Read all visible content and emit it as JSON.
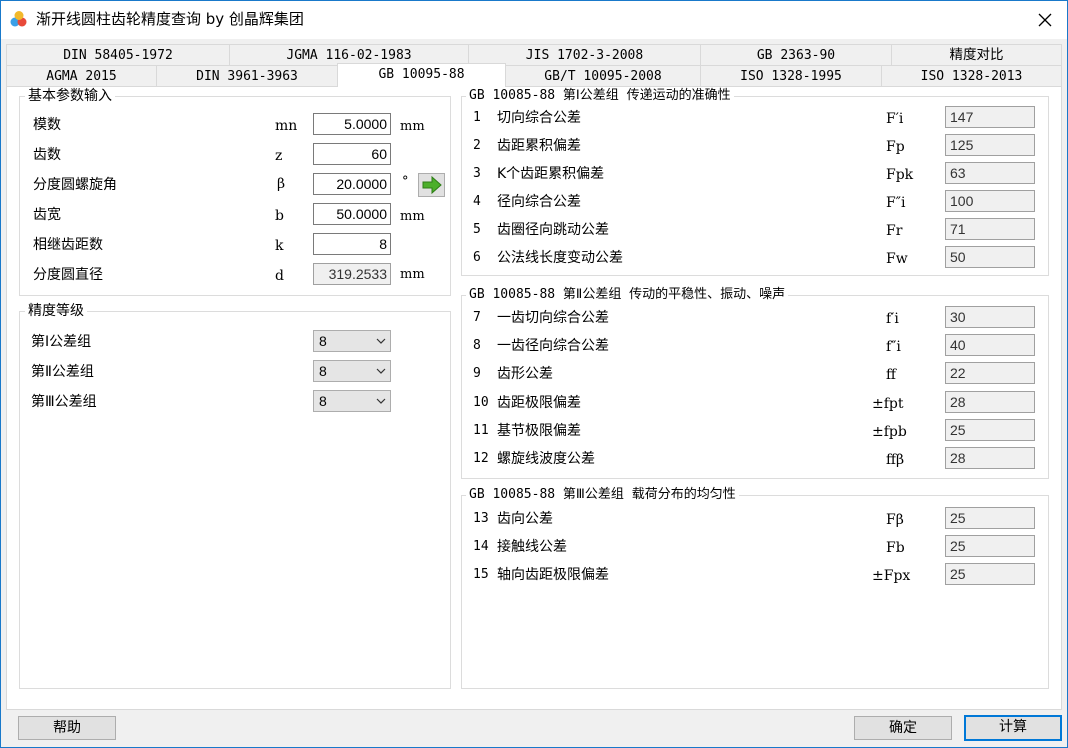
{
  "window": {
    "title": "渐开线圆柱齿轮精度查询 by 创晶辉集团"
  },
  "tabs_row1": [
    "DIN 58405-1972",
    "JGMA 116-02-1983",
    "JIS 1702-3-2008",
    "GB 2363-90",
    "精度对比"
  ],
  "tabs_row2": [
    "AGMA 2015",
    "DIN 3961-3963",
    "GB 10095-88",
    "GB/T 10095-2008",
    "ISO 1328-1995",
    "ISO 1328-2013"
  ],
  "basic_params": {
    "title": "基本参数输入",
    "rows": [
      {
        "label": "模数",
        "symbol": "mn",
        "value": "5.0000",
        "unit": "mm"
      },
      {
        "label": "齿数",
        "symbol": "z",
        "value": "60",
        "unit": ""
      },
      {
        "label": "分度圆螺旋角",
        "symbol": "β",
        "value": "20.0000",
        "unit": "°"
      },
      {
        "label": "齿宽",
        "symbol": "b",
        "value": "50.0000",
        "unit": "mm"
      },
      {
        "label": "相继齿距数",
        "symbol": "k",
        "value": "8",
        "unit": ""
      },
      {
        "label": "分度圆直径",
        "symbol": "d",
        "value": "319.2533",
        "unit": "mm"
      }
    ]
  },
  "accuracy": {
    "title": "精度等级",
    "rows": [
      {
        "label": "第Ⅰ公差组",
        "value": "8"
      },
      {
        "label": "第Ⅱ公差组",
        "value": "8"
      },
      {
        "label": "第Ⅲ公差组",
        "value": "8"
      }
    ]
  },
  "group1": {
    "title": "GB 10085-88 第Ⅰ公差组 传递运动的准确性",
    "rows": [
      {
        "no": "1",
        "name": "切向综合公差",
        "symbol": "F′i",
        "value": "147"
      },
      {
        "no": "2",
        "name": "齿距累积偏差",
        "symbol": "Fp",
        "value": "125"
      },
      {
        "no": "3",
        "name": "K个齿距累积偏差",
        "symbol": "Fpk",
        "value": "63"
      },
      {
        "no": "4",
        "name": "径向综合公差",
        "symbol": "F″i",
        "value": "100"
      },
      {
        "no": "5",
        "name": "齿圈径向跳动公差",
        "symbol": "Fr",
        "value": "71"
      },
      {
        "no": "6",
        "name": "公法线长度变动公差",
        "symbol": "Fw",
        "value": "50"
      }
    ]
  },
  "group2": {
    "title": "GB 10085-88 第Ⅱ公差组 传动的平稳性、振动、噪声",
    "rows": [
      {
        "no": "7",
        "name": "一齿切向综合公差",
        "symbol": "f′i",
        "value": "30"
      },
      {
        "no": "8",
        "name": "一齿径向综合公差",
        "symbol": "f″i",
        "value": "40"
      },
      {
        "no": "9",
        "name": "齿形公差",
        "symbol": "ff",
        "value": "22"
      },
      {
        "no": "10",
        "name": "齿距极限偏差",
        "symbol": "±fpt",
        "value": "28"
      },
      {
        "no": "11",
        "name": "基节极限偏差",
        "symbol": "±fpb",
        "value": "25"
      },
      {
        "no": "12",
        "name": "螺旋线波度公差",
        "symbol": "ffβ",
        "value": "28"
      }
    ]
  },
  "group3": {
    "title": "GB 10085-88 第Ⅲ公差组 载荷分布的均匀性",
    "rows": [
      {
        "no": "13",
        "name": "齿向公差",
        "symbol": "Fβ",
        "value": "25"
      },
      {
        "no": "14",
        "name": "接触线公差",
        "symbol": "Fb",
        "value": "25"
      },
      {
        "no": "15",
        "name": "轴向齿距极限偏差",
        "symbol": "±Fpx",
        "value": "25"
      }
    ]
  },
  "buttons": {
    "help": "帮助",
    "ok": "确定",
    "calc": "计算"
  },
  "colors": {
    "accent": "#0078d7",
    "arrow_green": "#4caf2a"
  }
}
